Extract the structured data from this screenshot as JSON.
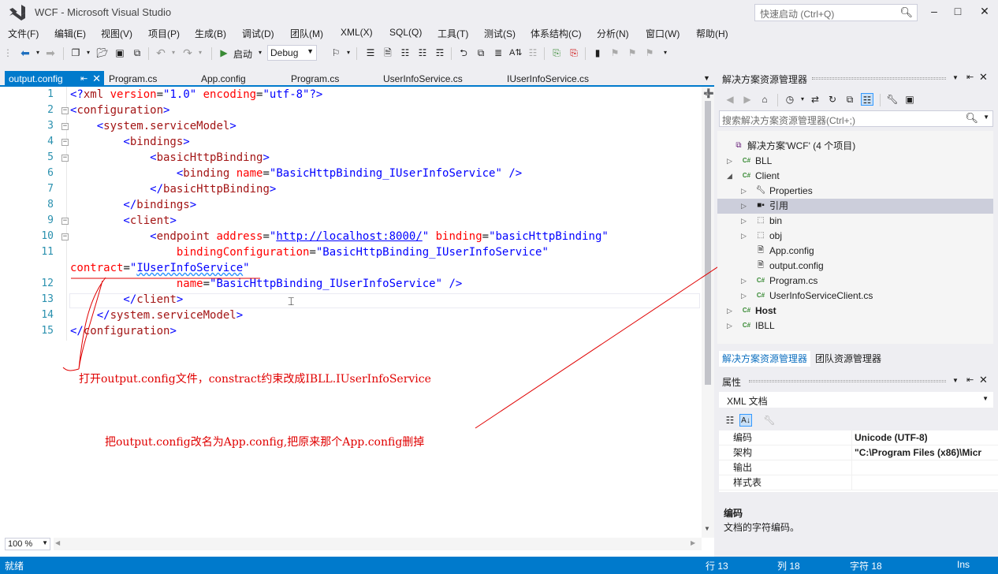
{
  "window": {
    "title": "WCF - Microsoft Visual Studio",
    "quick_launch_placeholder": "快速启动 (Ctrl+Q)",
    "minimize": "–",
    "maximize": "□",
    "close": "✕"
  },
  "menu": [
    "文件(F)",
    "编辑(E)",
    "视图(V)",
    "项目(P)",
    "生成(B)",
    "调试(D)",
    "团队(M)",
    "XML(X)",
    "SQL(Q)",
    "工具(T)",
    "测试(S)",
    "体系结构(C)",
    "分析(N)",
    "窗口(W)",
    "帮助(H)"
  ],
  "toolbar": {
    "start_label": "启动",
    "config_value": "Debug"
  },
  "doc_tabs": [
    {
      "label": "output.config",
      "active": true
    },
    {
      "label": "Program.cs"
    },
    {
      "label": "App.config"
    },
    {
      "label": "Program.cs"
    },
    {
      "label": "UserInfoService.cs"
    },
    {
      "label": "IUserInfoService.cs"
    }
  ],
  "editor": {
    "zoom": "100 %",
    "lines": [
      {
        "num": "1",
        "fold": "",
        "tokens": [
          [
            "<?",
            "d"
          ],
          [
            "xml",
            "e"
          ],
          [
            " version",
            "a"
          ],
          [
            "=",
            "p"
          ],
          [
            "\"1.0\"",
            "v"
          ],
          [
            " encoding",
            "a"
          ],
          [
            "=",
            "p"
          ],
          [
            "\"utf-8\"",
            "v"
          ],
          [
            "?>",
            "d"
          ]
        ]
      },
      {
        "num": "2",
        "fold": "−",
        "tokens": [
          [
            "<",
            "d"
          ],
          [
            "configuration",
            "e"
          ],
          [
            ">",
            "d"
          ]
        ]
      },
      {
        "num": "3",
        "fold": "−",
        "tokens": [
          [
            "    <",
            "d"
          ],
          [
            "system.serviceModel",
            "e"
          ],
          [
            ">",
            "d"
          ]
        ]
      },
      {
        "num": "4",
        "fold": "−",
        "tokens": [
          [
            "        <",
            "d"
          ],
          [
            "bindings",
            "e"
          ],
          [
            ">",
            "d"
          ]
        ]
      },
      {
        "num": "5",
        "fold": "−",
        "tokens": [
          [
            "            <",
            "d"
          ],
          [
            "basicHttpBinding",
            "e"
          ],
          [
            ">",
            "d"
          ]
        ]
      },
      {
        "num": "6",
        "fold": "",
        "tokens": [
          [
            "                <",
            "d"
          ],
          [
            "binding",
            "e"
          ],
          [
            " name",
            "a"
          ],
          [
            "=",
            "p"
          ],
          [
            "\"BasicHttpBinding_IUserInfoService\"",
            "v"
          ],
          [
            " />",
            "d"
          ]
        ]
      },
      {
        "num": "7",
        "fold": "",
        "tokens": [
          [
            "            </",
            "d"
          ],
          [
            "basicHttpBinding",
            "e"
          ],
          [
            ">",
            "d"
          ]
        ]
      },
      {
        "num": "8",
        "fold": "",
        "tokens": [
          [
            "        </",
            "d"
          ],
          [
            "bindings",
            "e"
          ],
          [
            ">",
            "d"
          ]
        ]
      },
      {
        "num": "9",
        "fold": "−",
        "tokens": [
          [
            "        <",
            "d"
          ],
          [
            "client",
            "e"
          ],
          [
            ">",
            "d"
          ]
        ]
      },
      {
        "num": "10",
        "fold": "−",
        "tokens": [
          [
            "            <",
            "d"
          ],
          [
            "endpoint",
            "e"
          ],
          [
            " address",
            "a"
          ],
          [
            "=",
            "p"
          ],
          [
            "\"",
            "v"
          ],
          [
            "http://localhost:8000/",
            "l"
          ],
          [
            "\"",
            "v"
          ],
          [
            " binding",
            "a"
          ],
          [
            "=",
            "p"
          ],
          [
            "\"basicHttpBinding\"",
            "v"
          ]
        ]
      },
      {
        "num": "11",
        "fold": "",
        "tokens": [
          [
            "                bindingConfiguration",
            "a"
          ],
          [
            "=",
            "p"
          ],
          [
            "\"BasicHttpBinding_IUserInfoService\"",
            "v"
          ]
        ]
      },
      {
        "num": "",
        "fold": "",
        "tokens": [
          [
            "contract",
            "a"
          ],
          [
            "=",
            "p"
          ],
          [
            "\"",
            "v"
          ],
          [
            "IUserInfoService",
            "u"
          ],
          [
            "\"",
            "v"
          ]
        ]
      },
      {
        "num": "12",
        "fold": "",
        "tokens": [
          [
            "                name",
            "a"
          ],
          [
            "=",
            "p"
          ],
          [
            "\"BasicHttpBinding_IUserInfoService\"",
            "v"
          ],
          [
            " />",
            "d"
          ]
        ]
      },
      {
        "num": "13",
        "fold": "",
        "tokens": [
          [
            "        </",
            "d"
          ],
          [
            "client",
            "e"
          ],
          [
            ">",
            "d"
          ]
        ]
      },
      {
        "num": "14",
        "fold": "",
        "tokens": [
          [
            "    </",
            "d"
          ],
          [
            "system.serviceModel",
            "e"
          ],
          [
            ">",
            "d"
          ]
        ]
      },
      {
        "num": "15",
        "fold": "",
        "tokens": [
          [
            "</",
            "d"
          ],
          [
            "configuration",
            "e"
          ],
          [
            ">",
            "d"
          ]
        ]
      }
    ]
  },
  "annotations": {
    "note1": "打开output.config文件，constract约束改成IBLL.IUserInfoService",
    "note2": "把output.config改名为App.config,把原来那个App.config删掉",
    "color": "#e00000"
  },
  "solution_explorer": {
    "title": "解决方案资源管理器",
    "search_placeholder": "搜索解决方案资源管理器(Ctrl+;)",
    "items": [
      {
        "label": "解决方案'WCF' (4 个项目)",
        "depth": 0,
        "arrow": "",
        "icon": "solution-icon"
      },
      {
        "label": "BLL",
        "depth": 0,
        "arrow": "▷",
        "icon": "csharp-project-icon"
      },
      {
        "label": "Client",
        "depth": 0,
        "arrow": "◢",
        "icon": "csharp-project-icon"
      },
      {
        "label": "Properties",
        "depth": 1,
        "arrow": "▷",
        "icon": "wrench-icon"
      },
      {
        "label": "引用",
        "depth": 1,
        "arrow": "▷",
        "icon": "references-icon",
        "selected": true
      },
      {
        "label": "bin",
        "depth": 1,
        "arrow": "▷",
        "icon": "folder-dashed-icon"
      },
      {
        "label": "obj",
        "depth": 1,
        "arrow": "▷",
        "icon": "folder-dashed-icon"
      },
      {
        "label": "App.config",
        "depth": 1,
        "arrow": "",
        "icon": "config-file-icon"
      },
      {
        "label": "output.config",
        "depth": 1,
        "arrow": "",
        "icon": "config-file-icon"
      },
      {
        "label": "Program.cs",
        "depth": 1,
        "arrow": "▷",
        "icon": "csharp-file-icon"
      },
      {
        "label": "UserInfoServiceClient.cs",
        "depth": 1,
        "arrow": "▷",
        "icon": "csharp-file-icon"
      },
      {
        "label": "Host",
        "depth": 0,
        "arrow": "▷",
        "icon": "csharp-project-icon",
        "bold": true
      },
      {
        "label": "IBLL",
        "depth": 0,
        "arrow": "▷",
        "icon": "csharp-project-icon"
      }
    ],
    "bottom_tabs": [
      "解决方案资源管理器",
      "团队资源管理器"
    ]
  },
  "properties": {
    "title": "属性",
    "object": "XML 文档",
    "rows": [
      {
        "name": "编码",
        "value": "Unicode (UTF-8)"
      },
      {
        "name": "架构",
        "value": "\"C:\\Program Files (x86)\\Micr"
      },
      {
        "name": "输出",
        "value": ""
      },
      {
        "name": "样式表",
        "value": ""
      }
    ],
    "desc_title": "编码",
    "desc_text": "文档的字符编码。"
  },
  "status": {
    "state": "就绪",
    "line": "行 13",
    "col": "列 18",
    "char": "字符 18",
    "mode": "Ins"
  },
  "colors": {
    "accent": "#007acc",
    "annotation": "#e00000"
  }
}
